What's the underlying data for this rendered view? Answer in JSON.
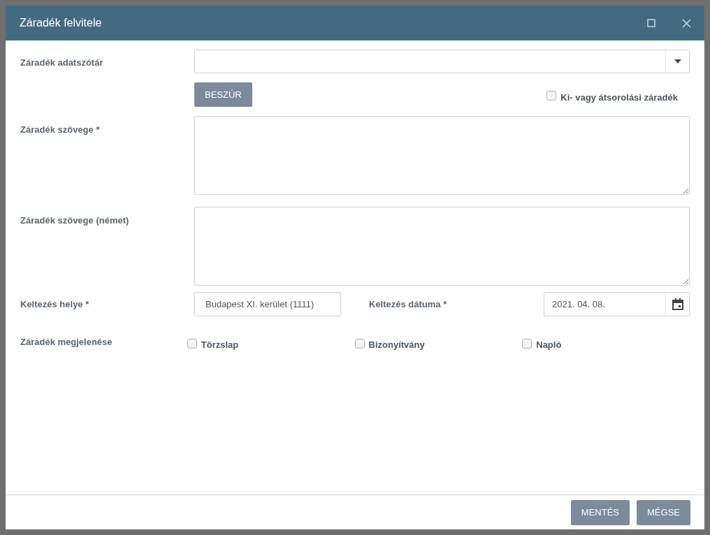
{
  "window": {
    "title": "Záradék felvitele"
  },
  "dictionary": {
    "label": "Záradék adatszótár"
  },
  "insert_button": "BESZÚR",
  "reclassification": {
    "label": "Ki- vagy átsorolási záradék",
    "checked": false
  },
  "text": {
    "label": "Záradék szövege *"
  },
  "text_german": {
    "label": "Záradék szövege (német)"
  },
  "place": {
    "label": "Keltezés helye *",
    "value": "Budapest XI. kerület (1111)"
  },
  "date": {
    "label": "Keltezés dátuma *",
    "value": "2021. 04. 08."
  },
  "appearance": {
    "label": "Záradék megjelenése",
    "options": [
      {
        "label": "Törzslap",
        "checked": false
      },
      {
        "label": "Bizonyítvány",
        "checked": false
      },
      {
        "label": "Napló",
        "checked": false
      }
    ]
  },
  "buttons": [
    "MENTÉS",
    "MÉGSE"
  ]
}
